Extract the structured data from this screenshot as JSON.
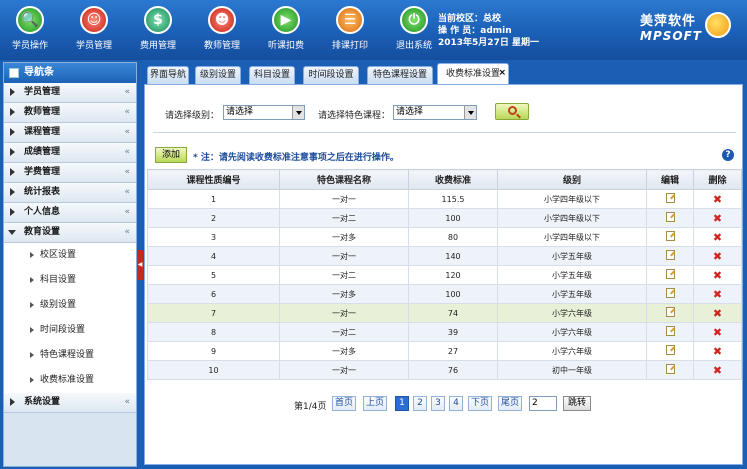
{
  "toolbar": [
    {
      "label": "学员操作",
      "icon": "magnifier-icon",
      "glyph": "🔍",
      "color": "green"
    },
    {
      "label": "学员管理",
      "icon": "student-manage-icon",
      "glyph": "☺",
      "color": "red"
    },
    {
      "label": "费用管理",
      "icon": "fee-icon",
      "glyph": "$",
      "color": "teal"
    },
    {
      "label": "教师管理",
      "icon": "teacher-icon",
      "glyph": "☻",
      "color": "red"
    },
    {
      "label": "听课扣费",
      "icon": "listen-icon",
      "glyph": "▶",
      "color": "green"
    },
    {
      "label": "排课打印",
      "icon": "print-icon",
      "glyph": "☰",
      "color": "orange"
    },
    {
      "label": "退出系统",
      "icon": "power-icon",
      "glyph": "⏻",
      "color": "green"
    }
  ],
  "header_info": {
    "campus": "当前校区：总校",
    "operator": "操 作 员：admin",
    "date": "2013年5月27日 星期一"
  },
  "brand": {
    "name_cn": "美萍软件",
    "name_en": "MPSOFT"
  },
  "sidebar": {
    "title": "导航条",
    "items": [
      {
        "label": "学员管理"
      },
      {
        "label": "教师管理"
      },
      {
        "label": "课程管理"
      },
      {
        "label": "成绩管理"
      },
      {
        "label": "学费管理"
      },
      {
        "label": "统计报表"
      },
      {
        "label": "个人信息"
      },
      {
        "label": "教育设置"
      }
    ],
    "sub_items": [
      {
        "label": "校区设置"
      },
      {
        "label": "科目设置"
      },
      {
        "label": "级别设置"
      },
      {
        "label": "时间段设置"
      },
      {
        "label": "特色课程设置"
      },
      {
        "label": "收费标准设置"
      }
    ],
    "last_item": {
      "label": "系统设置"
    },
    "chev": "«"
  },
  "tabs": [
    {
      "label": "界面导航"
    },
    {
      "label": "级别设置"
    },
    {
      "label": "科目设置"
    },
    {
      "label": "时间段设置"
    },
    {
      "label": "特色课程设置"
    },
    {
      "label": "收费标准设置"
    }
  ],
  "tab_close": "×",
  "filter": {
    "level_label": "请选择级别：",
    "level_value": "请选择",
    "course_label": "请选择特色课程：",
    "course_value": "请选择"
  },
  "actions": {
    "add_label": "添加",
    "note": "* 注：请先阅读收费标准注意事项之后在进行操作。",
    "help": "?"
  },
  "table": {
    "columns": [
      "课程性质编号",
      "特色课程名称",
      "收费标准",
      "级别",
      "编辑",
      "删除"
    ],
    "rows": [
      [
        "1",
        "一对一",
        "115.5",
        "小学四年级以下"
      ],
      [
        "2",
        "一对二",
        "100",
        "小学四年级以下"
      ],
      [
        "3",
        "一对多",
        "80",
        "小学四年级以下"
      ],
      [
        "4",
        "一对一",
        "140",
        "小学五年级"
      ],
      [
        "5",
        "一对二",
        "120",
        "小学五年级"
      ],
      [
        "6",
        "一对多",
        "100",
        "小学五年级"
      ],
      [
        "7",
        "一对一",
        "74",
        "小学六年级"
      ],
      [
        "8",
        "一对二",
        "39",
        "小学六年级"
      ],
      [
        "9",
        "一对多",
        "27",
        "小学六年级"
      ],
      [
        "10",
        "一对一",
        "76",
        "初中一年级"
      ]
    ],
    "delete_glyph": "✖"
  },
  "pager": {
    "info": "第1/4页",
    "first": "首页",
    "prev": "上页",
    "pages": [
      "1",
      "2",
      "3",
      "4"
    ],
    "next": "下页",
    "last": "尾页",
    "input_value": "2",
    "go": "跳转"
  }
}
